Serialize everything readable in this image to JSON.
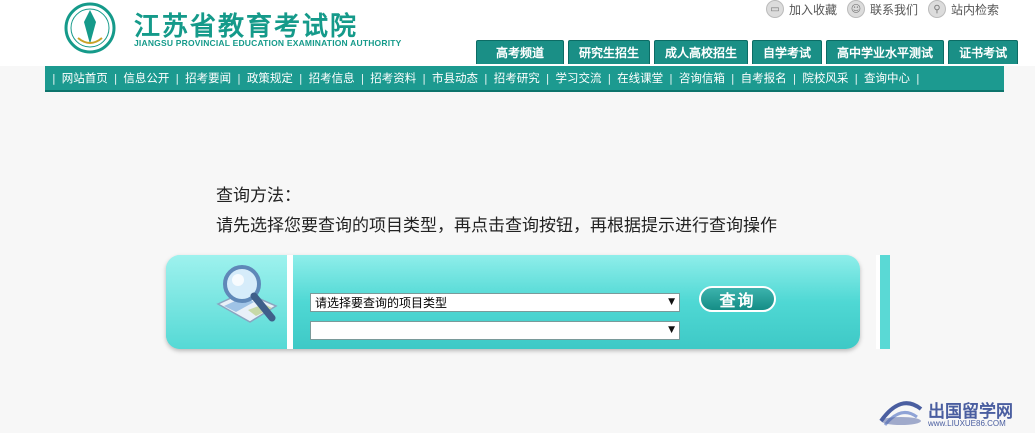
{
  "header": {
    "site_title": "江苏省教育考试院",
    "site_subtitle": "JIANGSU PROVINCIAL EDUCATION EXAMINATION AUTHORITY",
    "top_links": [
      {
        "label": "加入收藏",
        "icon": "bookmark-icon"
      },
      {
        "label": "联系我们",
        "icon": "contact-icon"
      },
      {
        "label": "站内检索",
        "icon": "search-icon"
      }
    ],
    "tabs": [
      "高考频道",
      "研究生招生",
      "成人高校招生",
      "自学考试",
      "高中学业水平测试",
      "证书考试"
    ]
  },
  "nav": {
    "items": [
      "网站首页",
      "信息公开",
      "招考要闻",
      "政策规定",
      "招考信息",
      "招考资料",
      "市县动态",
      "招考研究",
      "学习交流",
      "在线课堂",
      "咨询信箱",
      "自考报名",
      "院校风采",
      "查询中心"
    ]
  },
  "main": {
    "instruction_title": "查询方法：",
    "instruction_text": "请先选择您要查询的项目类型，再点击查询按钮，再根据提示进行查询操作",
    "select_type": {
      "selected": "请选择要查询的项目类型"
    },
    "select_sub": {
      "selected": ""
    },
    "query_label": "查询"
  },
  "watermark": {
    "text": "出国留学网",
    "url": "www.LIUXUE86.COM"
  },
  "colors": {
    "brand": "#159a8a",
    "nav": "#1c9a90",
    "panel": "#4fd8d4",
    "button": "#158d86"
  }
}
